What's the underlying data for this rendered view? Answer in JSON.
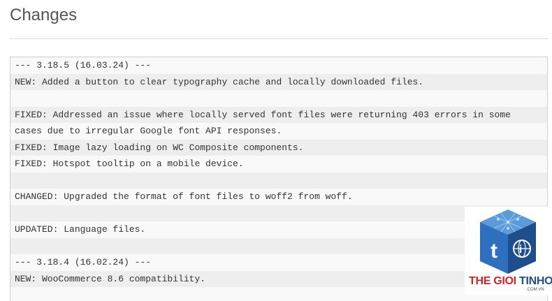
{
  "heading": "Changes",
  "changelog": {
    "lines": [
      "--- 3.18.5 (16.03.24) ---",
      "NEW: Added a button to clear typography cache and locally downloaded files.",
      "",
      "FIXED: Addressed an issue where locally served font files were returning 403 errors in some",
      "cases due to irregular Google font API responses.",
      "FIXED: Image lazy loading on WC Composite components.",
      "FIXED: Hotspot tooltip on a mobile device.",
      "",
      "CHANGED: Upgraded the format of font files to woff2 from woff.",
      "",
      "UPDATED: Language files.",
      "",
      "--- 3.18.4 (16.02.24) ---",
      "NEW: WooCommerce 8.6 compatibility.",
      ""
    ]
  },
  "watermark": {
    "icon": "cube-logo-icon",
    "brand_red": "THE GIOI ",
    "brand_blue": "TINHOC",
    "domain": ".COM.VN",
    "colors": {
      "red": "#d2232a",
      "blue": "#1f4e8c",
      "cube": "#2f6fbf"
    }
  }
}
